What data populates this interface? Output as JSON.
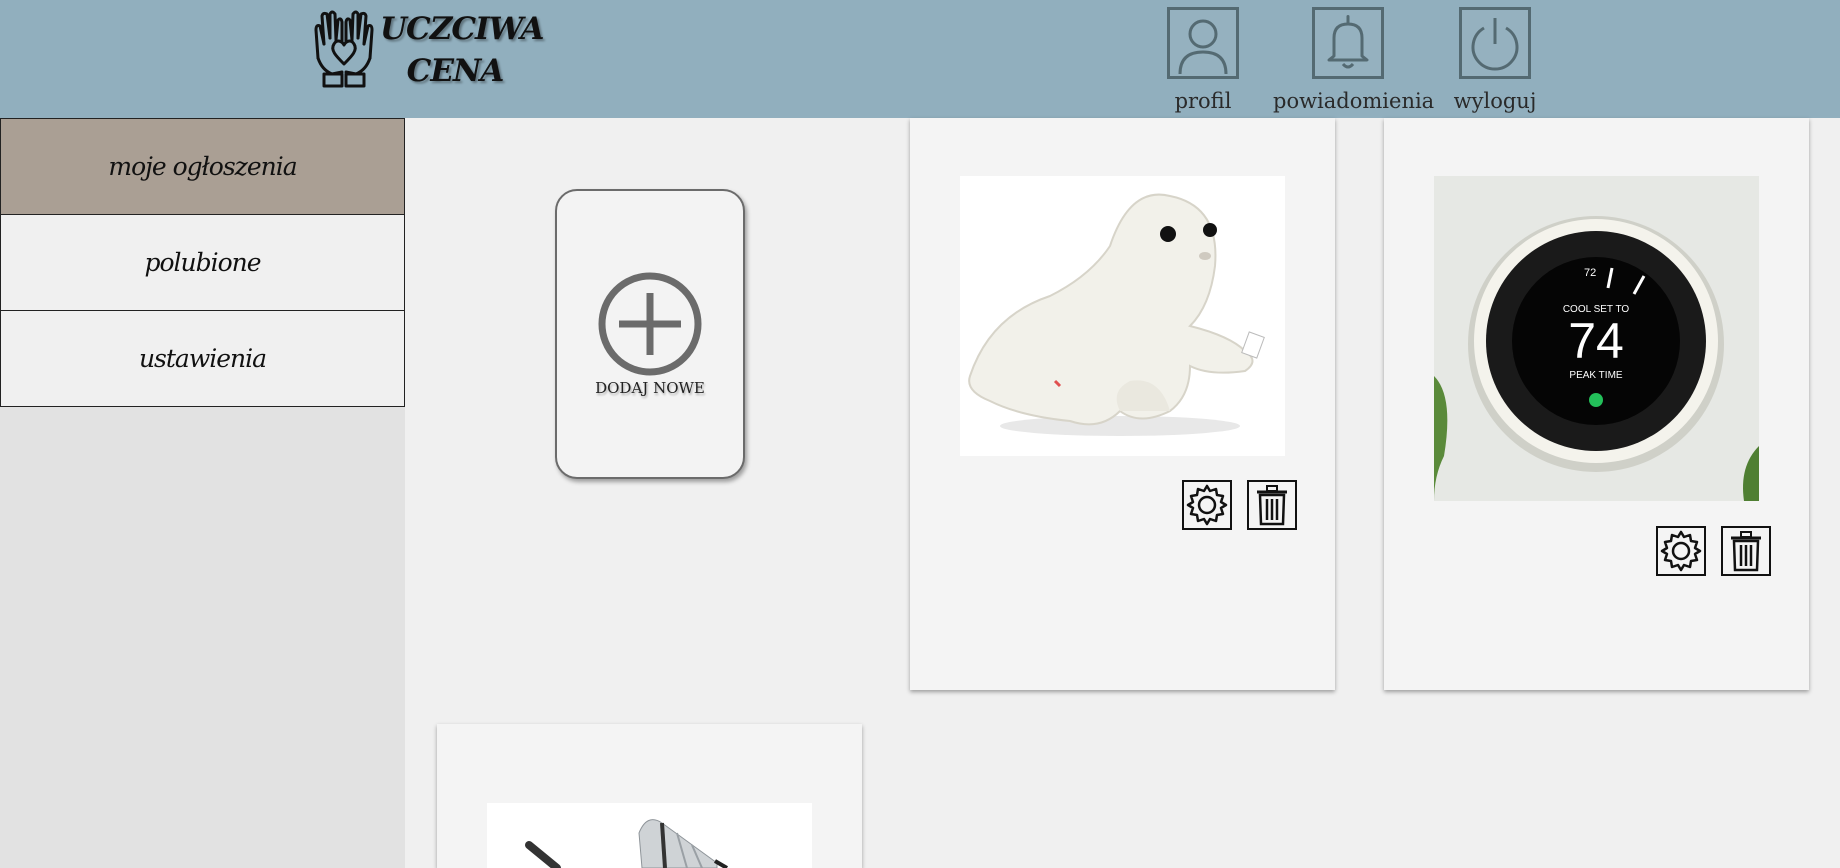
{
  "header": {
    "logo_line1": "UCZCIWA",
    "logo_line2": "CENA",
    "nav": [
      {
        "label": "profil",
        "icon": "user-icon"
      },
      {
        "label": "powiadomienia",
        "icon": "bell-icon"
      },
      {
        "label": "wyloguj",
        "icon": "power-icon"
      }
    ]
  },
  "sidebar": {
    "items": [
      {
        "label": "moje ogłoszenia",
        "active": true
      },
      {
        "label": "polubione",
        "active": false
      },
      {
        "label": "ustawienia",
        "active": false
      }
    ]
  },
  "main": {
    "add_new_label": "DODAJ NOWE",
    "listings": [
      {
        "image": "white plush seal toy",
        "actions": [
          "gear-icon",
          "trash-icon"
        ]
      },
      {
        "image": "smart thermostat",
        "thermostat": {
          "top_value": "72",
          "mode": "COOL SET TO",
          "value": "74",
          "status": "PEAK TIME"
        },
        "actions": [
          "gear-icon",
          "trash-icon"
        ]
      },
      {
        "image": "baby stroller",
        "actions": []
      }
    ]
  },
  "colors": {
    "header_bg": "#91afbe",
    "sidebar_active": "#aa9f94",
    "page_bg": "#f0f0f0"
  }
}
